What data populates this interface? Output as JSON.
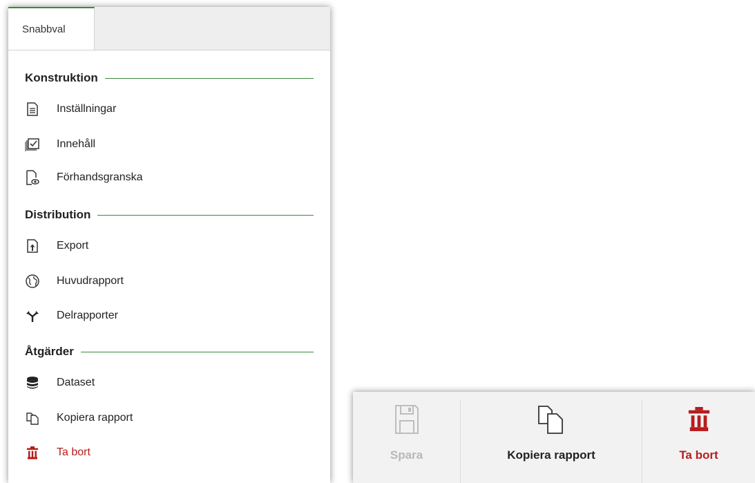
{
  "tab": {
    "label": "Snabbval"
  },
  "sections": [
    {
      "title": "Konstruktion"
    },
    {
      "title": "Distribution"
    },
    {
      "title": "Åtgärder"
    }
  ],
  "items": {
    "installningar": {
      "label": "Inställningar",
      "icon": "document-icon"
    },
    "innehall": {
      "label": "Innehåll",
      "icon": "checklist-icon"
    },
    "forhandsgranska": {
      "label": "Förhandsgranska",
      "icon": "preview-icon"
    },
    "export": {
      "label": "Export",
      "icon": "export-icon"
    },
    "huvudrapport": {
      "label": "Huvudrapport",
      "icon": "globe-icon"
    },
    "delrapporter": {
      "label": "Delrapporter",
      "icon": "split-icon"
    },
    "dataset": {
      "label": "Dataset",
      "icon": "database-icon"
    },
    "kopiera": {
      "label": "Kopiera rapport",
      "icon": "copy-icon"
    },
    "tabort": {
      "label": "Ta bort",
      "icon": "trash-icon"
    }
  },
  "toolbar": {
    "save_label": "Spara",
    "copy_label": "Kopiera rapport",
    "delete_label": "Ta bort"
  },
  "colors": {
    "accent": "#3a8a3a",
    "danger": "#b71c1c",
    "disabled": "#b8b8b8"
  }
}
